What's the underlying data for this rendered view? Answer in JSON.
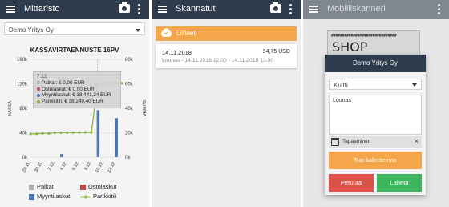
{
  "screen1": {
    "title": "Mittaristo",
    "company_select": "Demo Yritys Oy",
    "chart_data": {
      "type": "bar",
      "title": "KASSAVIRTAENNUSTE 16PV",
      "ylabel_left": "KASSA",
      "ylabel_right": "SUMMA",
      "categories": [
        "28.11.",
        "30.11.",
        "2.12.",
        "4.12.",
        "6.12.",
        "8.12.",
        "10.12.",
        "12.12."
      ],
      "left_ticks": [
        "0k",
        "40k",
        "80k",
        "120k",
        "160k"
      ],
      "right_ticks": [
        "0k",
        "20k",
        "40k",
        "60k",
        "80k"
      ],
      "ylim_left": [
        0,
        160000
      ],
      "ylim_right": [
        0,
        80000
      ],
      "x_days": [
        28,
        29,
        30,
        31,
        32,
        33,
        34,
        35,
        36,
        37,
        38,
        39,
        40,
        41,
        42,
        43
      ],
      "series": [
        {
          "name": "Palkat",
          "color": "#aaaaaa",
          "axis": "right",
          "values": [
            0,
            0,
            0,
            0,
            0,
            0,
            0,
            0,
            0,
            0,
            0,
            0,
            0,
            0,
            0,
            0
          ]
        },
        {
          "name": "Ostolaskut",
          "color": "#b24b4b",
          "axis": "right",
          "values": [
            0,
            0,
            0,
            0,
            0,
            0,
            0,
            0,
            0,
            0,
            0,
            0,
            0,
            0,
            0,
            0
          ]
        },
        {
          "name": "Myyntilaskut",
          "color": "#4a72b0",
          "axis": "right",
          "values": [
            0,
            0,
            0,
            0,
            0,
            2500,
            0,
            0,
            0,
            0,
            0,
            38441,
            0,
            0,
            32000,
            0
          ]
        },
        {
          "name": "Pankkitili",
          "color": "#8ab546",
          "axis": "left",
          "type": "line",
          "values": [
            38249,
            38249,
            39000,
            39000,
            40000,
            40200,
            40200,
            40400,
            40400,
            40600,
            40600,
            120000,
            121000,
            121000,
            121000,
            121000
          ]
        }
      ]
    },
    "tooltip": {
      "date": "7.12",
      "rows": [
        {
          "label": "Palkat: € 0,00 EUR",
          "color": "#aaaaaa"
        },
        {
          "label": "Ostolaskut: € 0,00 EUR",
          "color": "#b24b4b"
        },
        {
          "label": "Myyntilaskut: € 38.441,24 EUR",
          "color": "#4a72b0"
        },
        {
          "label": "Pankkitili: € 38.249,40 EUR",
          "color": "#8ab546"
        }
      ]
    },
    "legend": {
      "palkat": "Palkat",
      "ostolaskut": "Ostolaskut",
      "myyntilaskut": "Myyntilaskut",
      "pankkitili": "Pankkitili"
    }
  },
  "screen2": {
    "title": "Skannatut",
    "banner": "Liitteet",
    "receipt": {
      "date": "14.11.2018",
      "amount": "94,75 USD",
      "desc": "Lounas - 14.11.2018 12:00 - 14.11.2018 13:00"
    }
  },
  "screen3": {
    "title": "Mobiiliskanneri",
    "paper_hashes": "##############################",
    "paper_text": "SHOP",
    "dialog_title": "Demo Yritys Oy",
    "type_select": "Kuitti",
    "description": "Lounas",
    "attachment": "Tapaaminen",
    "attachment_close": "×",
    "calendar_button": "Tuo kalenterista",
    "cancel_button": "Peruuta",
    "send_button": "Lähetä"
  },
  "colors": {
    "appbar": "#2e3c4e",
    "orange": "#f4a74a",
    "cancel": "#d9534a",
    "send": "#3cb55c"
  }
}
